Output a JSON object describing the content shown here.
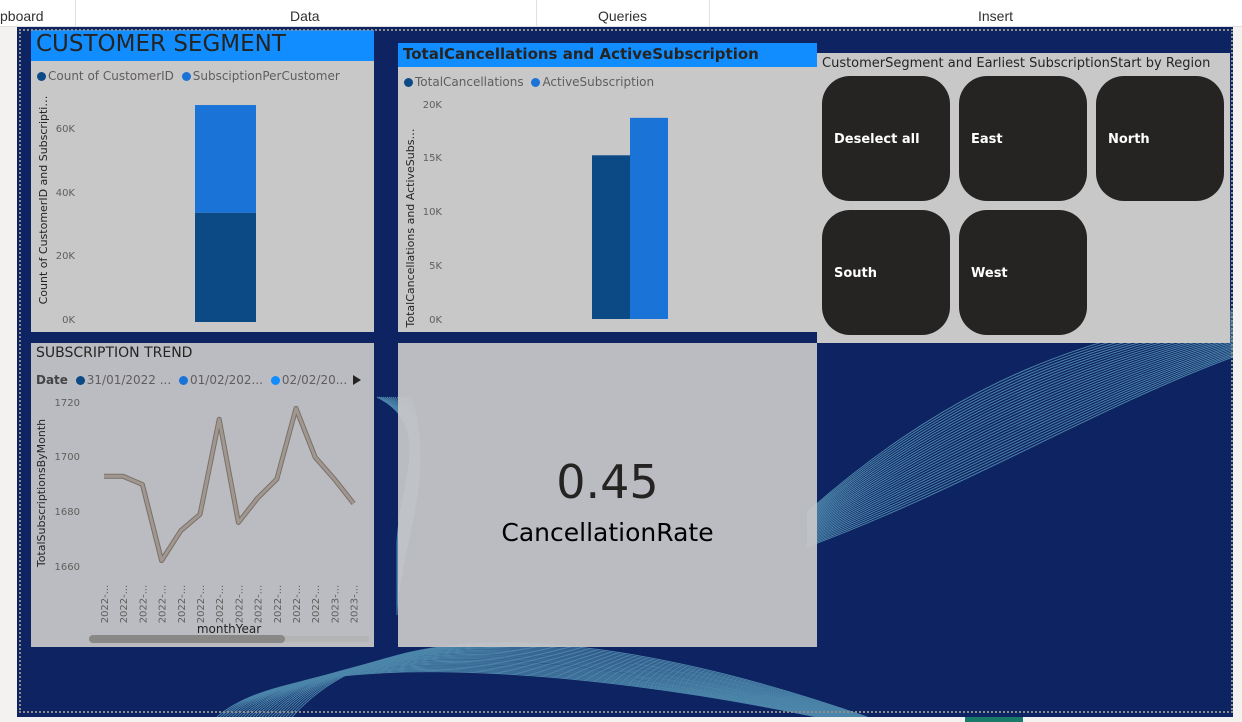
{
  "ribbon": {
    "tabs": [
      {
        "label": "pboard"
      },
      {
        "label": "Data"
      },
      {
        "label": "Queries"
      },
      {
        "label": "Insert"
      }
    ]
  },
  "customer_segment": {
    "title": "CUSTOMER SEGMENT",
    "legend": [
      "Count of CustomerID",
      "SubsciptionPerCustomer"
    ],
    "legend_colors": [
      "#0c4a86",
      "#1a73d6"
    ],
    "ylabel": "Count of CustomerID and Subscripti…",
    "yticks": [
      "0K",
      "20K",
      "40K",
      "60K"
    ]
  },
  "cancellations": {
    "title": "TotalCancellations and ActiveSubscription",
    "legend": [
      "TotalCancellations",
      "ActiveSubscription"
    ],
    "legend_colors": [
      "#0c4a86",
      "#1a73d6"
    ],
    "ylabel": "TotalCancellations and ActiveSubs…",
    "yticks": [
      "0K",
      "5K",
      "10K",
      "15K",
      "20K"
    ]
  },
  "slicer": {
    "title": "CustomerSegment and Earliest SubscriptionStart by Region",
    "buttons": [
      "Deselect all",
      "East",
      "North",
      "South",
      "West"
    ]
  },
  "trend": {
    "title": "SUBSCRIPTION TREND",
    "legend_label": "Date",
    "legend": [
      "31/01/2022 ...",
      "01/02/202...",
      "02/02/20..."
    ],
    "legend_colors": [
      "#0c4a86",
      "#1a73d6",
      "#118dff"
    ],
    "ylabel": "TotalSubscriptionsByMonth",
    "xlabel": "monthYear",
    "yticks": [
      "1660",
      "1680",
      "1700",
      "1720"
    ],
    "xticks": [
      "2022-...",
      "2022-...",
      "2022-...",
      "2022-...",
      "2022-...",
      "2022-...",
      "2022-...",
      "2022-...",
      "2022-...",
      "2022-...",
      "2022-...",
      "2022-...",
      "2023-...",
      "2023-..."
    ],
    "line_color": "#a09890"
  },
  "card": {
    "value": "0.45",
    "label": "CancellationRate"
  },
  "chart_data": [
    {
      "type": "bar",
      "stacked": true,
      "categories": [
        ""
      ],
      "series": [
        {
          "name": "Count of CustomerID",
          "values": [
            34000
          ]
        },
        {
          "name": "SubsciptionPerCustomer",
          "values": [
            33500
          ]
        }
      ],
      "title": "CUSTOMER SEGMENT",
      "ylabel": "Count of CustomerID and Subscripti…",
      "ylim": [
        0,
        70000
      ],
      "legend": "top-left"
    },
    {
      "type": "bar",
      "categories": [
        ""
      ],
      "series": [
        {
          "name": "TotalCancellations",
          "values": [
            15300
          ]
        },
        {
          "name": "ActiveSubscription",
          "values": [
            18800
          ]
        }
      ],
      "title": "TotalCancellations and ActiveSubscription",
      "ylabel": "TotalCancellations and ActiveSubs…",
      "ylim": [
        0,
        20000
      ],
      "legend": "top-left"
    },
    {
      "type": "line",
      "title": "SUBSCRIPTION TREND",
      "xlabel": "monthYear",
      "ylabel": "TotalSubscriptionsByMonth",
      "x": [
        1,
        2,
        3,
        4,
        5,
        6,
        7,
        8,
        9,
        10,
        11,
        12,
        13,
        14
      ],
      "series": [
        {
          "values": [
            1693,
            1693,
            1690,
            1662,
            1673,
            1679,
            1714,
            1676,
            1685,
            1692,
            1718,
            1700,
            1692,
            1683
          ]
        }
      ],
      "ylim": [
        1655,
        1724
      ],
      "legend": "top-left"
    }
  ]
}
